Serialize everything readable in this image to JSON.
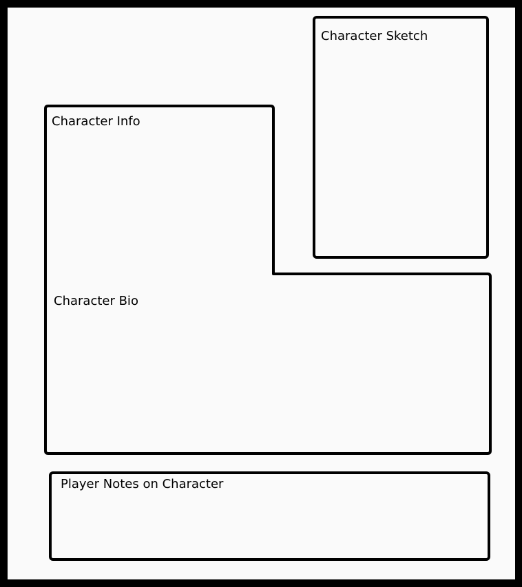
{
  "sheet": {
    "sections": {
      "character_sketch": "Character Sketch",
      "character_info": "Character Info",
      "character_bio": "Character Bio",
      "player_notes": "Player Notes on Character"
    }
  },
  "colors": {
    "page_background": "#fafafa",
    "border": "#000000",
    "text": "#000000"
  }
}
